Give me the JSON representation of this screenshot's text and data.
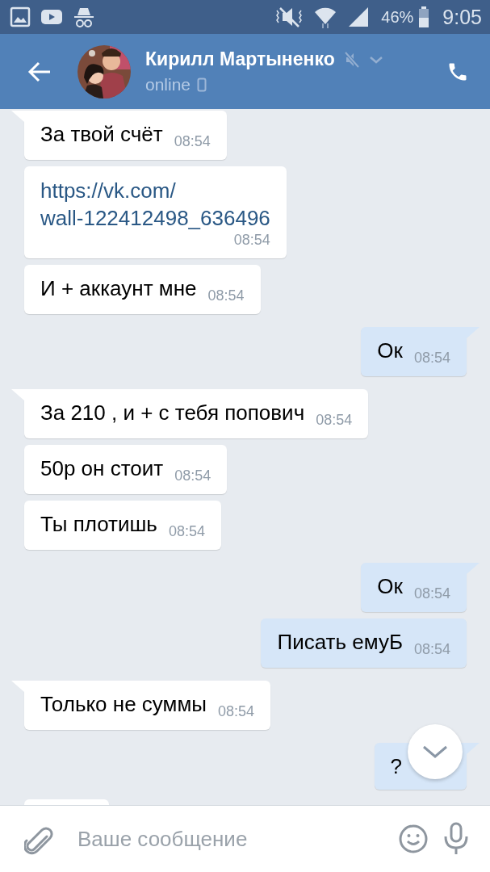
{
  "status_bar": {
    "battery": "46%",
    "time": "9:05"
  },
  "header": {
    "name": "Кирилл Мартыненко",
    "status": "online",
    "muted": true
  },
  "messages": [
    {
      "outgoing": false,
      "kind": "text",
      "tail": true,
      "text": "За твой счёт",
      "time": "08:54"
    },
    {
      "outgoing": false,
      "kind": "link",
      "tail": false,
      "text": "https://vk.com/\nwall-122412498_636496",
      "time": "08:54"
    },
    {
      "outgoing": false,
      "kind": "text",
      "tail": false,
      "text": "И + аккаунт мне",
      "time": "08:54"
    },
    {
      "outgoing": true,
      "kind": "text",
      "tail": true,
      "text": "Ок",
      "time": "08:54"
    },
    {
      "outgoing": false,
      "kind": "text",
      "tail": true,
      "text": "За 210 , и + с тебя попович",
      "time": "08:54"
    },
    {
      "outgoing": false,
      "kind": "text",
      "tail": false,
      "text": "50р он стоит",
      "time": "08:54"
    },
    {
      "outgoing": false,
      "kind": "text",
      "tail": false,
      "text": "Ты плотишь",
      "time": "08:54"
    },
    {
      "outgoing": true,
      "kind": "text",
      "tail": true,
      "text": "Ок",
      "time": "08:54"
    },
    {
      "outgoing": true,
      "kind": "text",
      "tail": false,
      "text": "Писать емуБ",
      "time": "08:54"
    },
    {
      "outgoing": false,
      "kind": "text",
      "tail": true,
      "text": "Только не суммы",
      "time": "08:54"
    },
    {
      "outgoing": true,
      "kind": "text",
      "tail": true,
      "text": "?"
    }
  ],
  "composer": {
    "placeholder": "Ваше сообщение"
  }
}
